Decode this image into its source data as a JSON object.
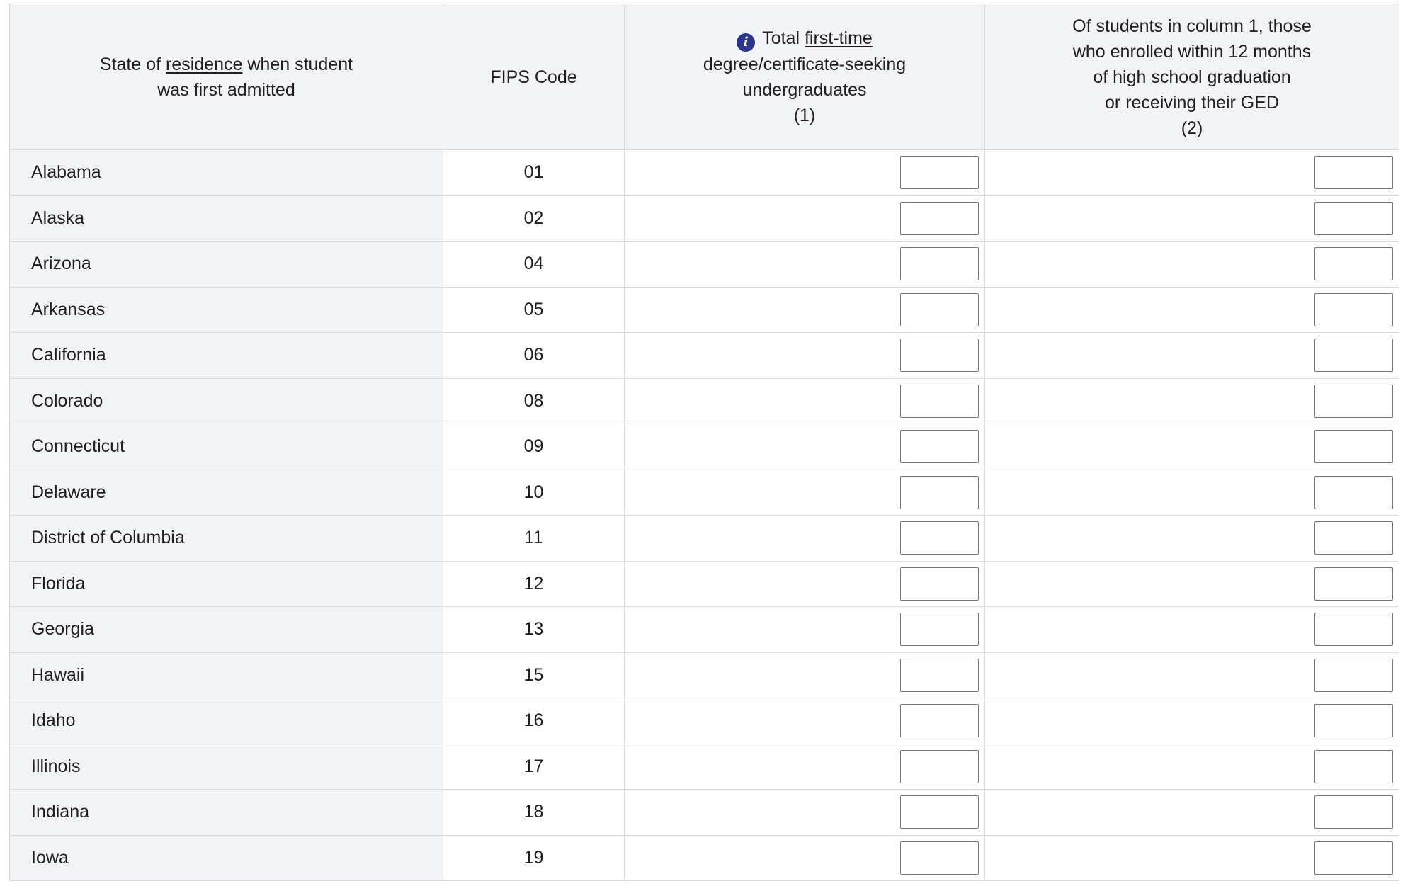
{
  "header": {
    "col_state": {
      "line1_pre": "State of ",
      "line1_link": "residence",
      "line1_post": " when student",
      "line2": "was first admitted"
    },
    "col_fips": "FIPS Code",
    "col_total": {
      "line1_pre": "Total ",
      "line1_link": "first-time",
      "line2": "degree/certificate-seeking",
      "line3": "undergraduates",
      "line4": "(1)"
    },
    "col_recent": {
      "line1": "Of students in column 1, those",
      "line2": "who enrolled within 12 months",
      "line3": "of high school graduation",
      "line4": "or receiving their GED",
      "line5": "(2)"
    }
  },
  "icons": {
    "info": "info-circle-icon",
    "info_color": "#2a3590"
  },
  "rows": [
    {
      "state": "Alabama",
      "fips": "01",
      "col1": "",
      "col2": ""
    },
    {
      "state": "Alaska",
      "fips": "02",
      "col1": "",
      "col2": ""
    },
    {
      "state": "Arizona",
      "fips": "04",
      "col1": "",
      "col2": ""
    },
    {
      "state": "Arkansas",
      "fips": "05",
      "col1": "",
      "col2": ""
    },
    {
      "state": "California",
      "fips": "06",
      "col1": "",
      "col2": ""
    },
    {
      "state": "Colorado",
      "fips": "08",
      "col1": "",
      "col2": ""
    },
    {
      "state": "Connecticut",
      "fips": "09",
      "col1": "",
      "col2": ""
    },
    {
      "state": "Delaware",
      "fips": "10",
      "col1": "",
      "col2": ""
    },
    {
      "state": "District of Columbia",
      "fips": "11",
      "col1": "",
      "col2": ""
    },
    {
      "state": "Florida",
      "fips": "12",
      "col1": "",
      "col2": ""
    },
    {
      "state": "Georgia",
      "fips": "13",
      "col1": "",
      "col2": ""
    },
    {
      "state": "Hawaii",
      "fips": "15",
      "col1": "",
      "col2": ""
    },
    {
      "state": "Idaho",
      "fips": "16",
      "col1": "",
      "col2": ""
    },
    {
      "state": "Illinois",
      "fips": "17",
      "col1": "",
      "col2": ""
    },
    {
      "state": "Indiana",
      "fips": "18",
      "col1": "",
      "col2": ""
    },
    {
      "state": "Iowa",
      "fips": "19",
      "col1": "",
      "col2": ""
    }
  ]
}
